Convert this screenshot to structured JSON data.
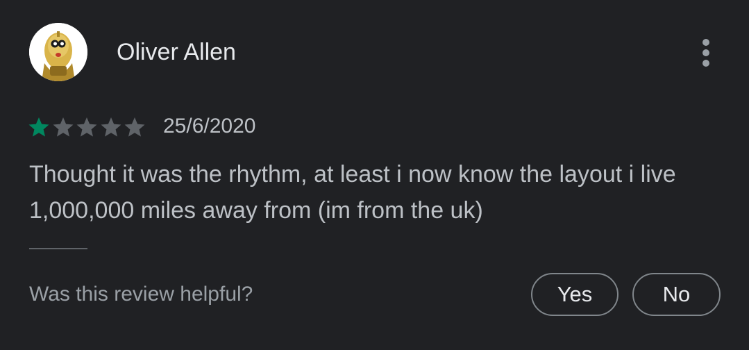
{
  "review": {
    "author": "Oliver Allen",
    "avatar_icon": "robot-avatar-icon",
    "menu_icon": "more-vert-icon",
    "rating": 1,
    "rating_max": 5,
    "date": "25/6/2020",
    "text": "Thought it was the rhythm, at least i now know the layout i live 1,000,000 miles away from (im from the uk)"
  },
  "feedback": {
    "prompt": "Was this review helpful?",
    "yes_label": "Yes",
    "no_label": "No"
  },
  "colors": {
    "background": "#202124",
    "star_filled": "#01875f",
    "star_empty": "#5f6368",
    "text_primary": "#e8eaed",
    "text_secondary": "#bdc1c6",
    "button_border": "#80868b"
  }
}
